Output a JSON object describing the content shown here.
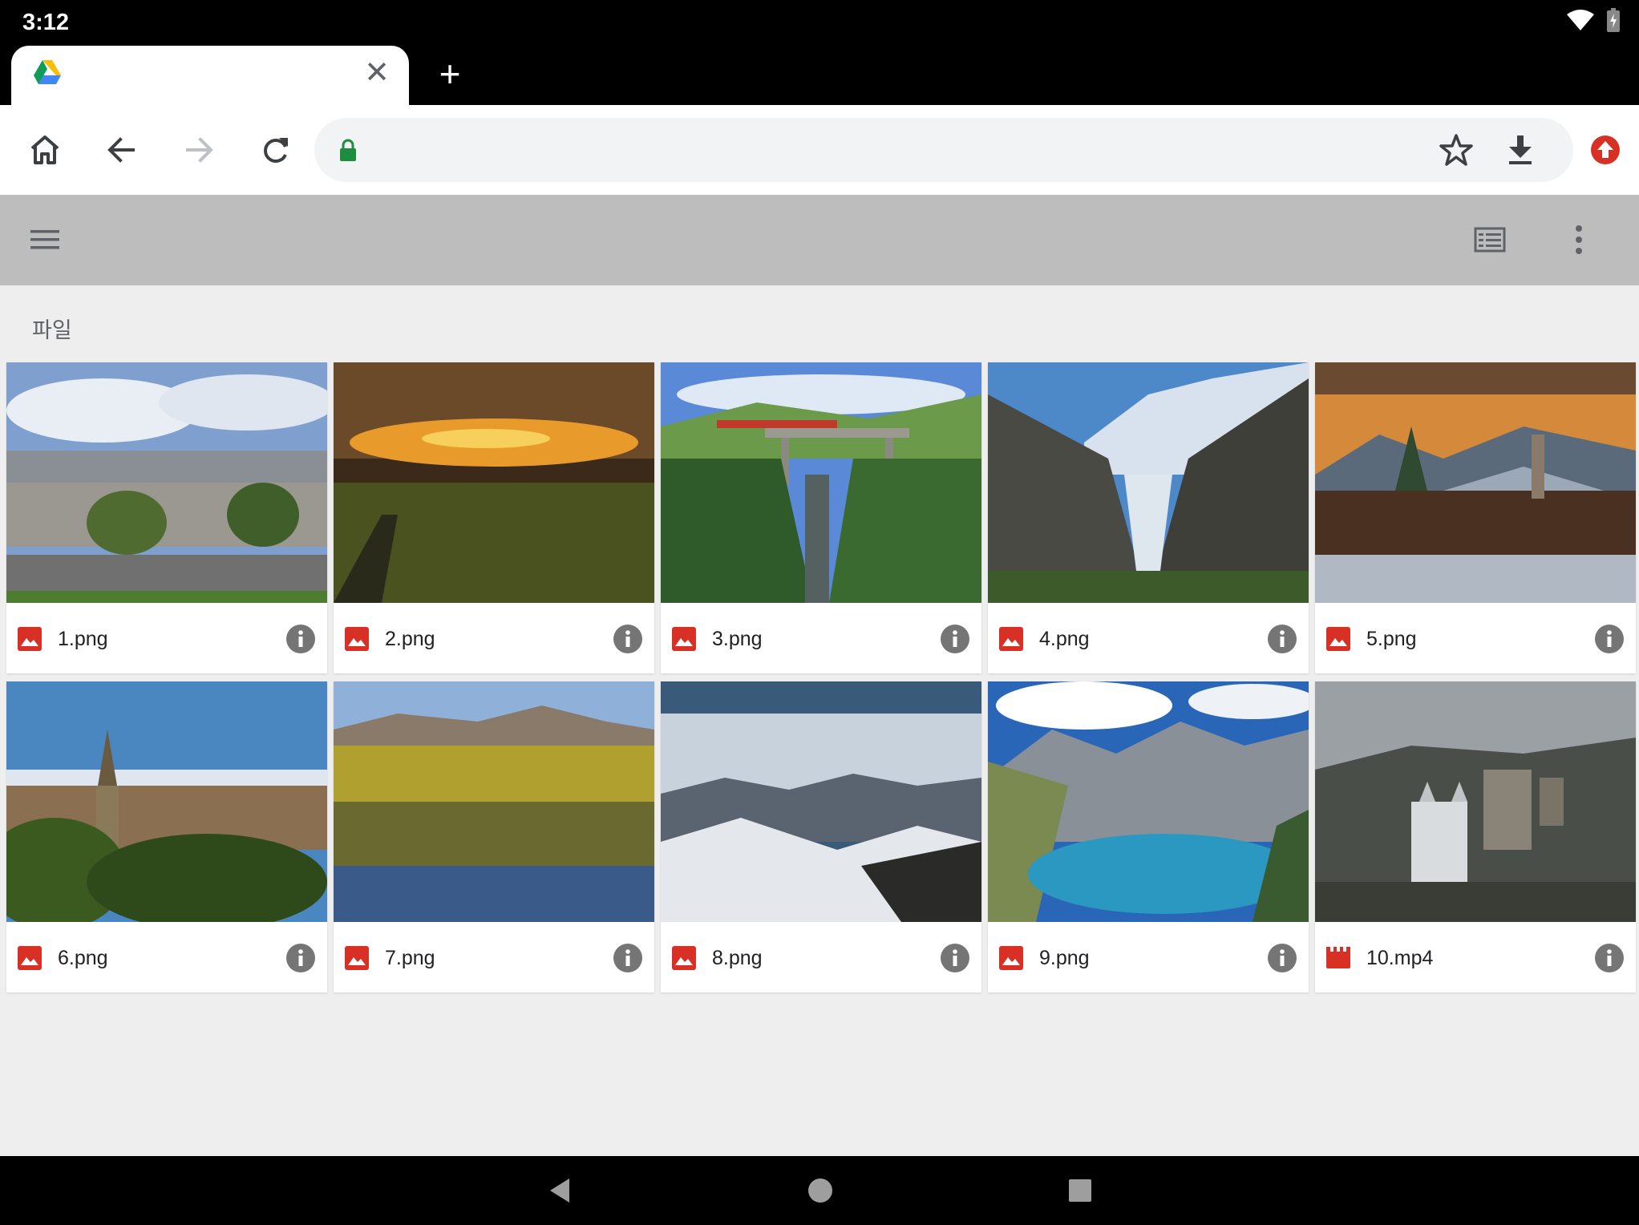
{
  "status_bar": {
    "time": "3:12"
  },
  "tab": {
    "favicon": "google-drive-icon",
    "close_glyph": "✕"
  },
  "new_tab_glyph": "+",
  "toolbar": {
    "icons": [
      "home-icon",
      "back-arrow-icon",
      "forward-arrow-icon",
      "reload-icon"
    ],
    "omnibox": {
      "url": "",
      "lock_color": "#1e8e3e"
    },
    "actions": [
      "bookmark-star-icon",
      "download-icon",
      "update-icon"
    ]
  },
  "appbar": {
    "menu_icon": "hamburger-menu-icon",
    "view_icon": "list-view-icon",
    "more_icon": "more-vert-icon"
  },
  "section_title": "파일",
  "files": [
    {
      "name": "1.png",
      "type": "image"
    },
    {
      "name": "2.png",
      "type": "image"
    },
    {
      "name": "3.png",
      "type": "image"
    },
    {
      "name": "4.png",
      "type": "image"
    },
    {
      "name": "5.png",
      "type": "image"
    },
    {
      "name": "6.png",
      "type": "image"
    },
    {
      "name": "7.png",
      "type": "image"
    },
    {
      "name": "8.png",
      "type": "image"
    },
    {
      "name": "9.png",
      "type": "image"
    },
    {
      "name": "10.mp4",
      "type": "video"
    }
  ],
  "colors": {
    "file_icon_red": "#d93025",
    "info_gray": "#757575",
    "appbar": "#bdbdbd",
    "content_bg": "#eeeeee"
  },
  "navbar": [
    "back-triangle-icon",
    "home-circle-icon",
    "recents-square-icon"
  ]
}
